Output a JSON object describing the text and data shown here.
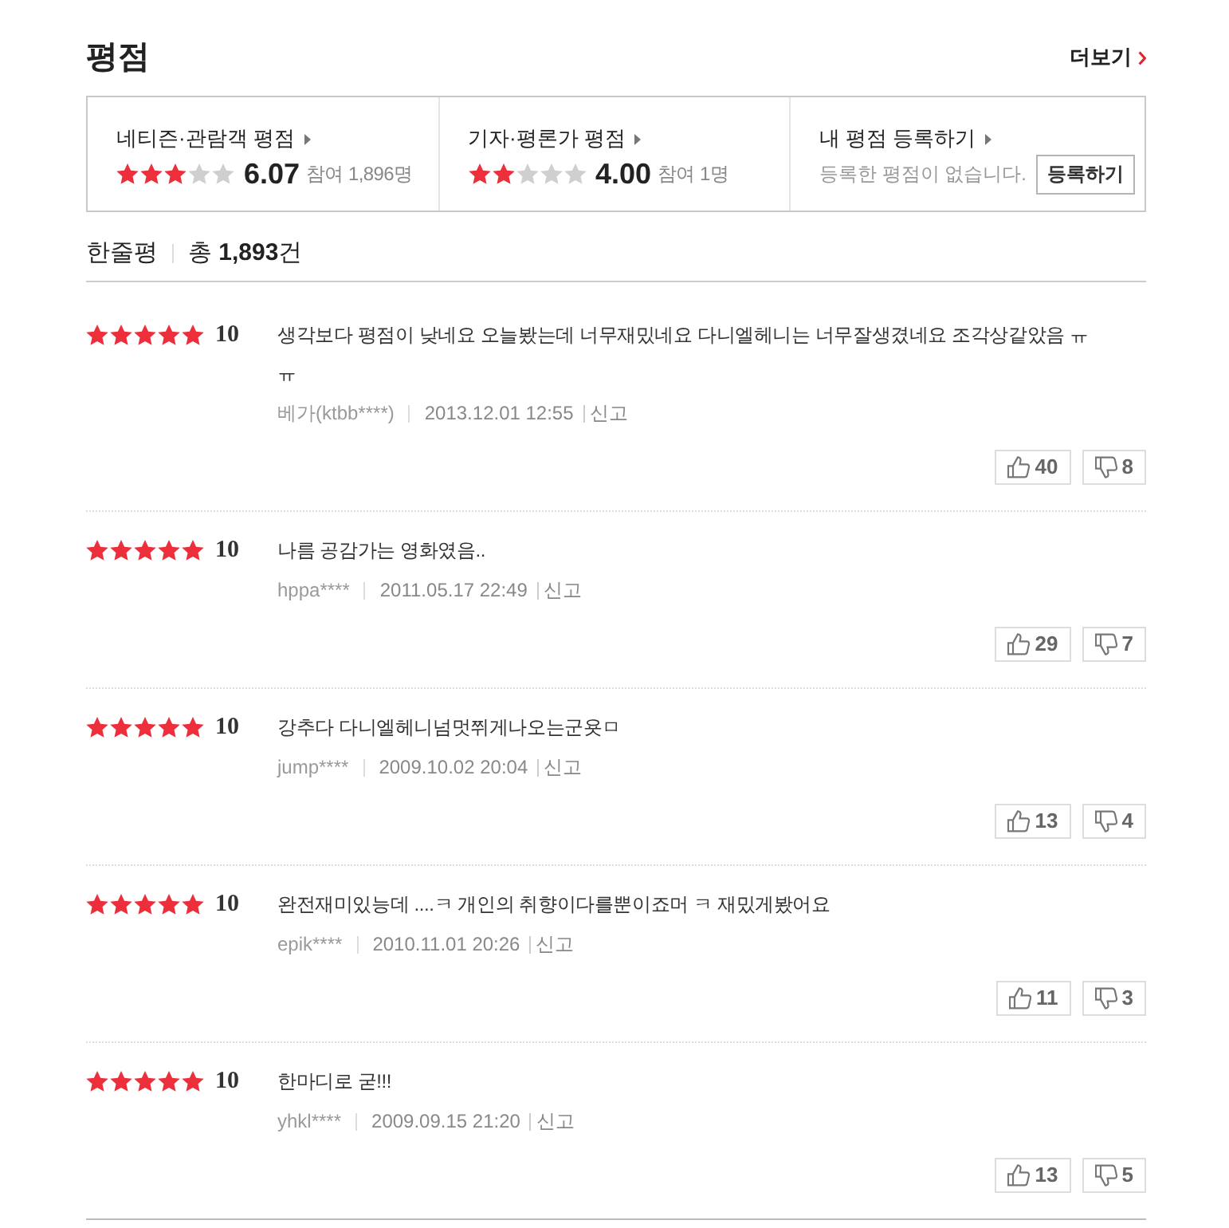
{
  "section": {
    "title": "평점",
    "more_link": "더보기"
  },
  "summary": [
    {
      "kind": "rating",
      "label": "네티즌·관람객 평점",
      "stars": 3,
      "score": "6.07",
      "participants": "참여 1,896명"
    },
    {
      "kind": "rating",
      "label": "기자·평론가 평점",
      "stars": 2,
      "score": "4.00",
      "participants": "참여 1명"
    },
    {
      "kind": "register",
      "label": "내 평점 등록하기",
      "message": "등록한 평점이 없습니다.",
      "button": "등록하기"
    }
  ],
  "reviews_header": {
    "title": "한줄평",
    "total": "총 **1,893**건"
  },
  "reviews": [
    {
      "stars": 5,
      "score": "10",
      "comment": "생각보다 평점이 낮네요 오늘봤는데 너무재밌네요 다니엘헤니는 너무잘생겼네요 조각상같았음 ㅠㅠ",
      "author": "베가(ktbb****)",
      "date": "2013.12.01 12:55",
      "report": "신고",
      "likes": "40",
      "dislikes": "8"
    },
    {
      "stars": 5,
      "score": "10",
      "comment": "나름 공감가는 영화였음..",
      "author": "hppa****",
      "date": "2011.05.17 22:49",
      "report": "신고",
      "likes": "29",
      "dislikes": "7"
    },
    {
      "stars": 5,
      "score": "10",
      "comment": "강추다 다니엘헤니넘멋쮜게나오는군욧ㅁ",
      "author": "jump****",
      "date": "2009.10.02 20:04",
      "report": "신고",
      "likes": "13",
      "dislikes": "4"
    },
    {
      "stars": 5,
      "score": "10",
      "comment": "완전재미있능데 ....ㅋ 개인의 취향이다를뿐이죠머 ㅋ 재밌게봤어요",
      "author": "epik****",
      "date": "2010.11.01 20:26",
      "report": "신고",
      "likes": "11",
      "dislikes": "3"
    },
    {
      "stars": 5,
      "score": "10",
      "comment": "한마디로 굳!!!",
      "author": "yhkl****",
      "date": "2009.09.15 21:20",
      "report": "신고",
      "likes": "13",
      "dislikes": "5"
    }
  ]
}
